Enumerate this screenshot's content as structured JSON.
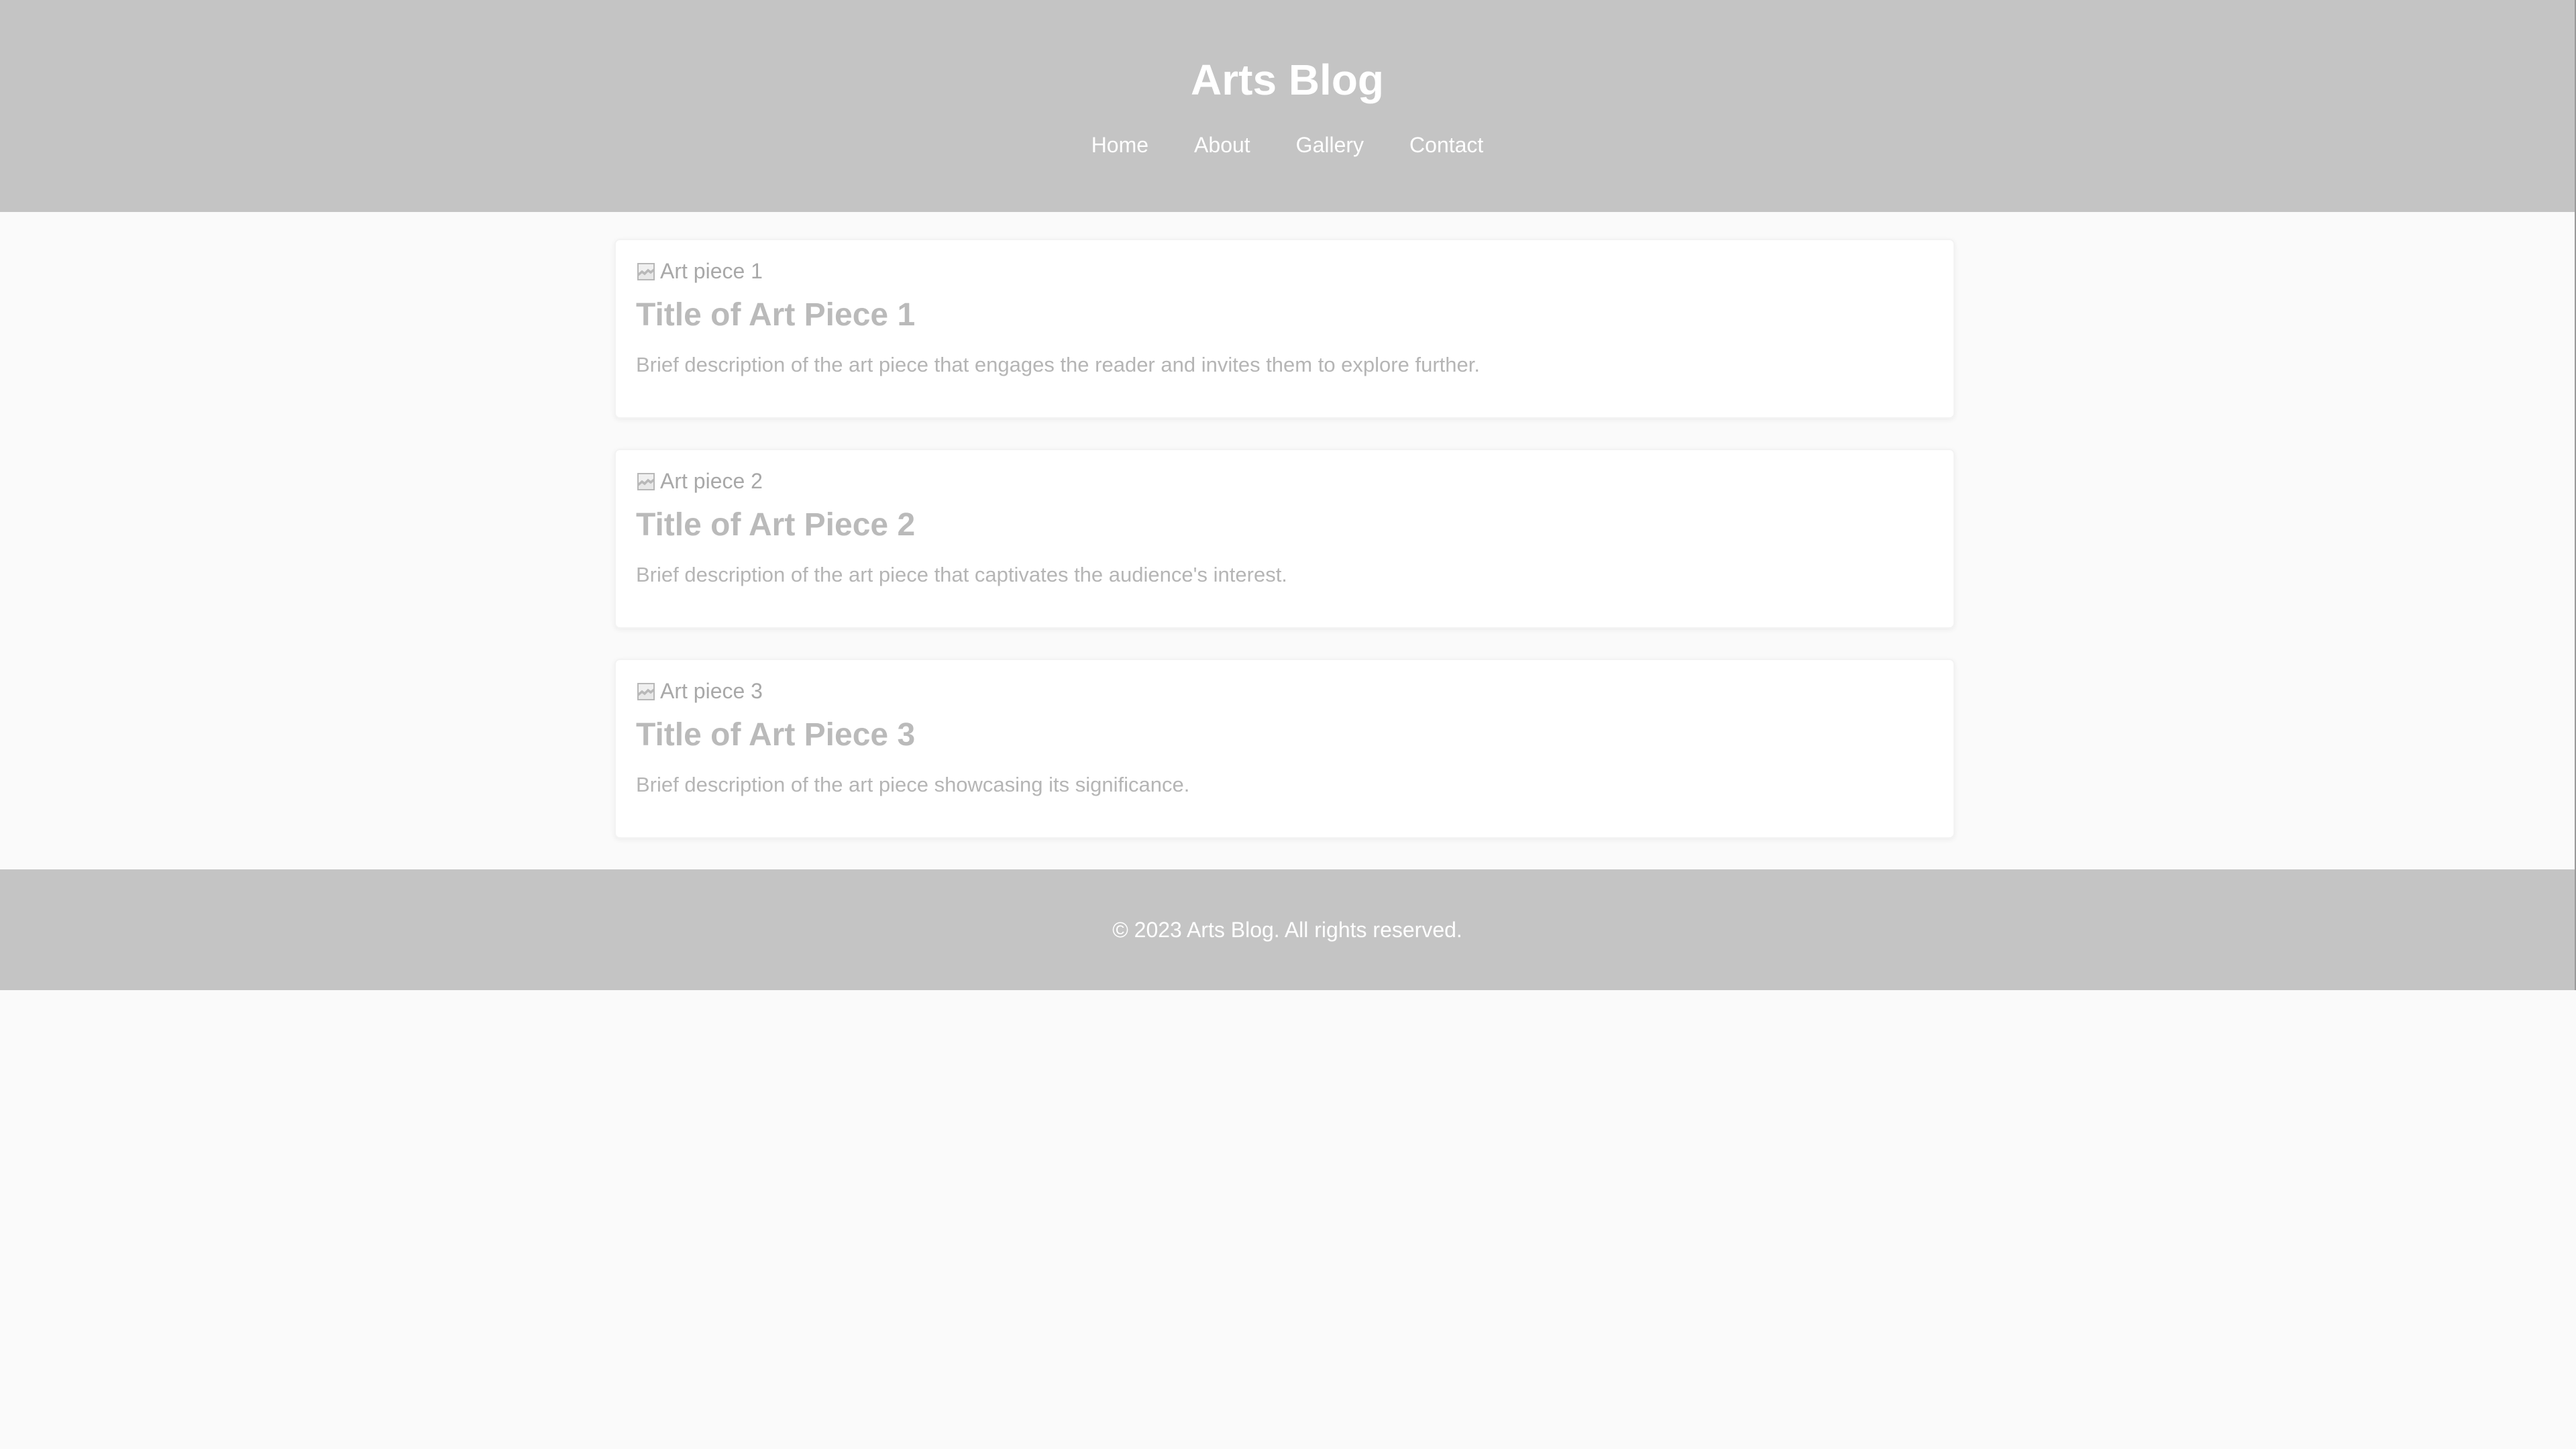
{
  "header": {
    "title": "Arts Blog",
    "nav": [
      "Home",
      "About",
      "Gallery",
      "Contact"
    ]
  },
  "posts": [
    {
      "image_alt": "Art piece 1",
      "title": "Title of Art Piece 1",
      "description": "Brief description of the art piece that engages the reader and invites them to explore further."
    },
    {
      "image_alt": "Art piece 2",
      "title": "Title of Art Piece 2",
      "description": "Brief description of the art piece that captivates the audience's interest."
    },
    {
      "image_alt": "Art piece 3",
      "title": "Title of Art Piece 3",
      "description": "Brief description of the art piece showcasing its significance."
    }
  ],
  "footer": {
    "text": "© 2023 Arts Blog. All rights reserved."
  },
  "colors": {
    "header_bg": "#c4c4c4",
    "page_bg": "#fafafa",
    "card_bg": "#ffffff"
  },
  "icons": {
    "broken_image": "broken-image-icon"
  }
}
